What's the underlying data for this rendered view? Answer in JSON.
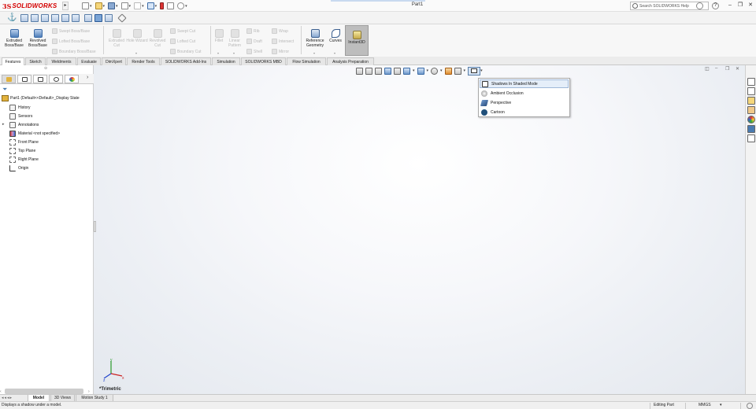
{
  "app": {
    "brand_prefix": "3S",
    "brand_name": "SOLIDWORKS",
    "doc_title": "Part1"
  },
  "help_search": {
    "placeholder": "Search SOLIDWORKS Help"
  },
  "window_controls": {
    "minimize": "–",
    "restore": "❐",
    "close": "✕"
  },
  "command_manager": {
    "extruded_boss": "Extruded Boss/Base",
    "revolved_boss": "Revolved Boss/Base",
    "swept_boss": "Swept Boss/Base",
    "lofted_boss": "Lofted Boss/Base",
    "boundary_boss": "Boundary Boss/Base",
    "extruded_cut": "Extruded Cut",
    "hole_wizard": "Hole Wizard",
    "revolved_cut": "Revolved Cut",
    "swept_cut": "Swept Cut",
    "lofted_cut": "Lofted Cut",
    "boundary_cut": "Boundary Cut",
    "fillet": "Fillet",
    "linear_pattern": "Linear Pattern",
    "rib": "Rib",
    "draft": "Draft",
    "shell": "Shell",
    "wrap": "Wrap",
    "intersect": "Intersect",
    "mirror": "Mirror",
    "reference_geometry": "Reference Geometry",
    "curves": "Curves",
    "instant3d": "Instant3D"
  },
  "tabs": [
    "Features",
    "Sketch",
    "Weldments",
    "Evaluate",
    "DimXpert",
    "Render Tools",
    "SOLIDWORKS Add-Ins",
    "Simulation",
    "SOLIDWORKS MBD",
    "Flow Simulation",
    "Analysis Preparation"
  ],
  "active_tab": "Features",
  "feature_tree": {
    "root": "Part1  (Default<<Default>_Display State",
    "items": [
      "History",
      "Sensors",
      "Annotations",
      "Material <not specified>",
      "Front Plane",
      "Top Plane",
      "Right Plane",
      "Origin"
    ]
  },
  "shading_menu": {
    "items": [
      "Shadows In Shaded Mode",
      "Ambient Occlusion",
      "Perspective",
      "Cartoon"
    ],
    "highlighted": "Shadows In Shaded Mode"
  },
  "viewport": {
    "view_name": "*Trimetric",
    "axis_x": "x",
    "axis_y": "y",
    "axis_z": "z"
  },
  "bottom_tabs": [
    "Model",
    "3D Views",
    "Motion Study 1"
  ],
  "active_bottom_tab": "Model",
  "status": {
    "message": "Displays a shadow under a model.",
    "mode": "Editing Part",
    "units": "MMGS",
    "units_dd": "▾"
  },
  "colors": {
    "brand_red": "#d40000",
    "accent_blue": "#2d5f9a",
    "menu_highlight": "#e5eef9"
  }
}
